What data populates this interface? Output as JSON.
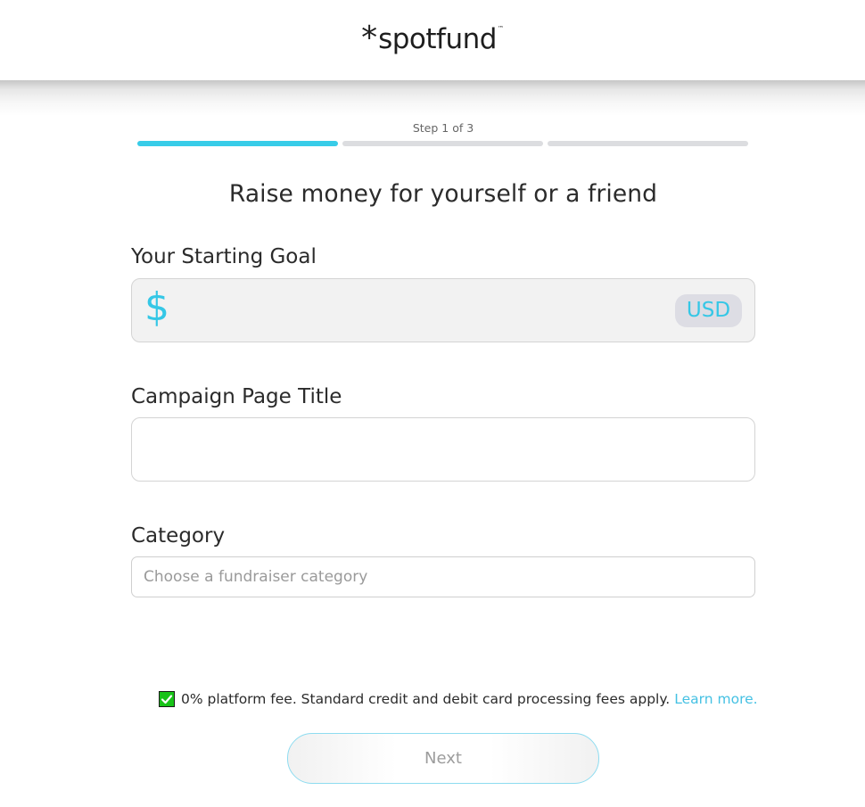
{
  "header": {
    "logo_asterisk": "*",
    "logo_text": "spotfund",
    "logo_tm": "™"
  },
  "progress": {
    "step_label": "Step 1 of 3",
    "current_step": 1,
    "total_steps": 3
  },
  "heading": "Raise money for yourself or a friend",
  "goal": {
    "label": "Your Starting Goal",
    "currency_symbol": "$",
    "currency_code": "USD",
    "value": ""
  },
  "title": {
    "label": "Campaign Page Title",
    "value": ""
  },
  "category": {
    "label": "Category",
    "placeholder": "Choose a fundraiser category"
  },
  "fee": {
    "checked": true,
    "text": "0% platform fee. Standard credit and debit card processing fees apply.",
    "link": "Learn more."
  },
  "next_button": "Next",
  "colors": {
    "accent": "#38cce8",
    "progress_inactive": "#dcdde0",
    "checkbox": "#18c318",
    "link": "#45c1e3"
  }
}
